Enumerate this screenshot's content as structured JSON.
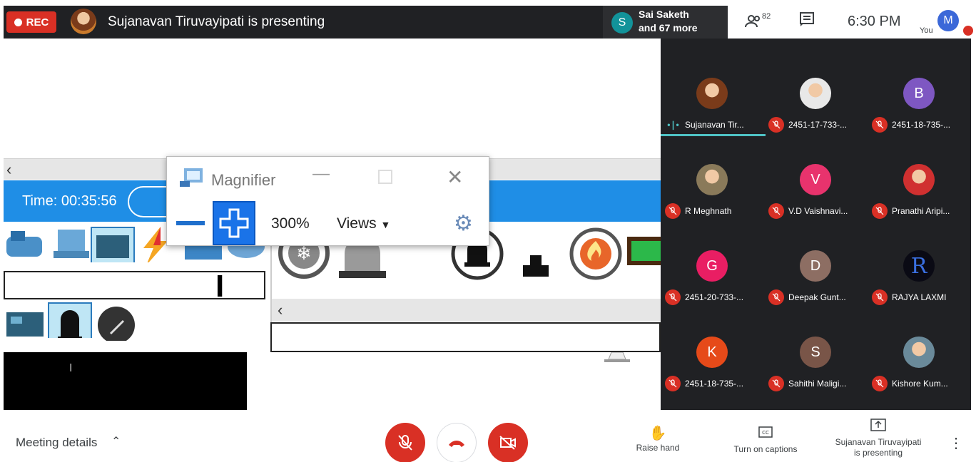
{
  "topbar": {
    "rec_label": "REC",
    "presenting_title": "Sujanavan Tiruvayipati is presenting",
    "others": {
      "avatar_letter": "S",
      "name": "Sai Saketh",
      "more": "and 67 more"
    },
    "people_count": "82",
    "time": "6:30 PM",
    "you_label": "You",
    "self_avatar_letter": "M"
  },
  "screen": {
    "time_readout": "Time: 00:35:56",
    "magnifier": {
      "title": "Magnifier",
      "zoom": "300%",
      "views_label": "Views"
    }
  },
  "participants": [
    {
      "name": "Sujanavan Tir...",
      "avatar": "",
      "color": "#7a3b1a",
      "speaking": true
    },
    {
      "name": "2451-17-733-...",
      "avatar": "",
      "color": "#e8e8e8",
      "speaking": false
    },
    {
      "name": "2451-18-735-...",
      "avatar": "B",
      "color": "#7e57c2",
      "speaking": false
    },
    {
      "name": "R Meghnath",
      "avatar": "",
      "color": "#8a7a5a",
      "speaking": false
    },
    {
      "name": "V.D Vaishnavi...",
      "avatar": "V",
      "color": "#e8336d",
      "speaking": false
    },
    {
      "name": "Pranathi Aripi...",
      "avatar": "",
      "color": "#d03030",
      "speaking": false
    },
    {
      "name": "2451-20-733-...",
      "avatar": "G",
      "color": "#e91e63",
      "speaking": false
    },
    {
      "name": "Deepak Gunt...",
      "avatar": "D",
      "color": "#8d6e63",
      "speaking": false
    },
    {
      "name": "RAJYA LAXMI",
      "avatar": "R",
      "color": "#0a0a14",
      "speaking": false
    },
    {
      "name": "2451-18-735-...",
      "avatar": "K",
      "color": "#e64a19",
      "speaking": false
    },
    {
      "name": "Sahithi Maligi...",
      "avatar": "S",
      "color": "#795548",
      "speaking": false
    },
    {
      "name": "Kishore Kum...",
      "avatar": "",
      "color": "#6a8a9a",
      "speaking": false
    }
  ],
  "bottombar": {
    "meeting_details": "Meeting details",
    "raise_hand": "Raise hand",
    "captions": "Turn on captions",
    "presenting_line1": "Sujanavan Tiruvayipati",
    "presenting_line2": "is presenting"
  }
}
